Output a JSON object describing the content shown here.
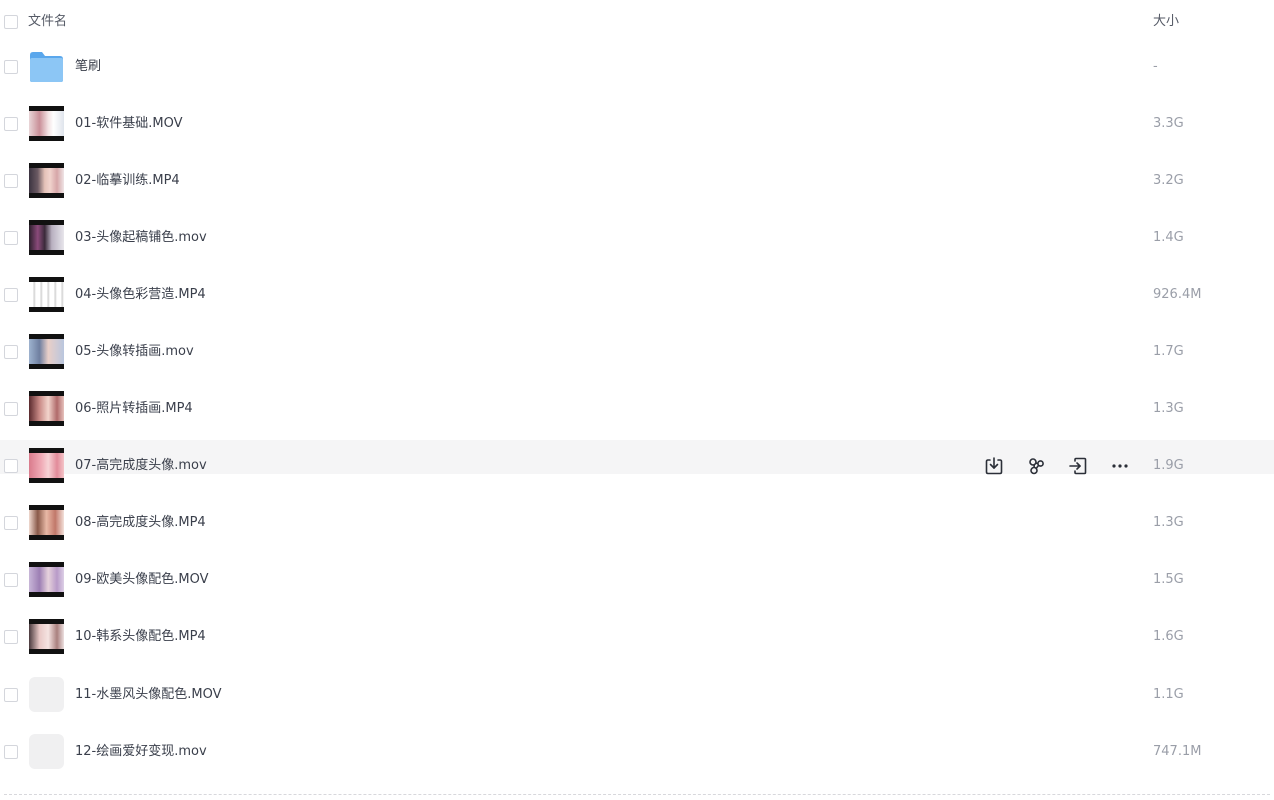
{
  "header": {
    "name_label": "文件名",
    "size_label": "大小"
  },
  "colors": {
    "folder": "#6fb7f0",
    "hover_row": "#f5f5f6",
    "text": "#3a3f4b",
    "muted_text": "#9a9ea8"
  },
  "files": [
    {
      "name": "笔刷",
      "size": "-",
      "type": "folder"
    },
    {
      "name": "01-软件基础.MOV",
      "size": "3.3G",
      "type": "video"
    },
    {
      "name": "02-临摹训练.MP4",
      "size": "3.2G",
      "type": "video"
    },
    {
      "name": "03-头像起稿铺色.mov",
      "size": "1.4G",
      "type": "video"
    },
    {
      "name": "04-头像色彩营造.MP4",
      "size": "926.4M",
      "type": "video"
    },
    {
      "name": "05-头像转插画.mov",
      "size": "1.7G",
      "type": "video"
    },
    {
      "name": "06-照片转插画.MP4",
      "size": "1.3G",
      "type": "video"
    },
    {
      "name": "07-高完成度头像.mov",
      "size": "1.9G",
      "type": "video",
      "hovered": true
    },
    {
      "name": "08-高完成度头像.MP4",
      "size": "1.3G",
      "type": "video"
    },
    {
      "name": "09-欧美头像配色.MOV",
      "size": "1.5G",
      "type": "video"
    },
    {
      "name": "10-韩系头像配色.MP4",
      "size": "1.6G",
      "type": "video"
    },
    {
      "name": "11-水墨风头像配色.MOV",
      "size": "1.1G",
      "type": "blank"
    },
    {
      "name": "12-绘画爱好变现.mov",
      "size": "747.1M",
      "type": "blank"
    }
  ],
  "row_actions": [
    {
      "icon": "download-icon"
    },
    {
      "icon": "share-icon"
    },
    {
      "icon": "move-to-icon"
    },
    {
      "icon": "more-icon"
    }
  ]
}
